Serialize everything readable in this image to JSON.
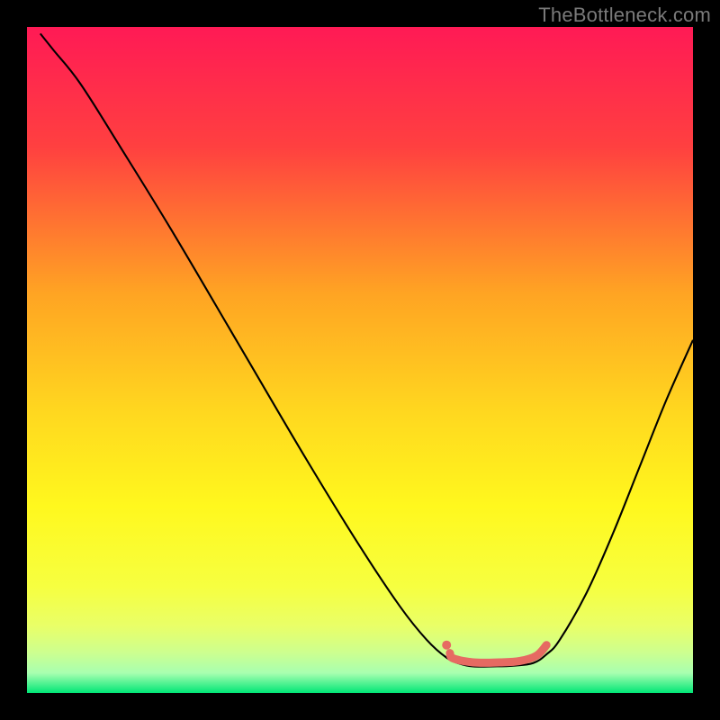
{
  "watermark": {
    "text": "TheBottleneck.com"
  },
  "chart_data": {
    "type": "line",
    "title": "",
    "xlabel": "",
    "ylabel": "",
    "xlim": [
      0,
      100
    ],
    "ylim": [
      0,
      100
    ],
    "grid": false,
    "legend": false,
    "background_gradient": {
      "stops": [
        {
          "offset": 0.0,
          "color": "#ff1a55"
        },
        {
          "offset": 0.18,
          "color": "#ff4040"
        },
        {
          "offset": 0.4,
          "color": "#ffa423"
        },
        {
          "offset": 0.58,
          "color": "#ffd81f"
        },
        {
          "offset": 0.72,
          "color": "#fff81e"
        },
        {
          "offset": 0.84,
          "color": "#f6ff40"
        },
        {
          "offset": 0.9,
          "color": "#e9ff68"
        },
        {
          "offset": 0.94,
          "color": "#ccff90"
        },
        {
          "offset": 0.97,
          "color": "#a8ffb0"
        },
        {
          "offset": 1.0,
          "color": "#00e676"
        }
      ]
    },
    "series": [
      {
        "name": "curve",
        "color": "#000000",
        "width": 2.1,
        "points": [
          {
            "x": 2.0,
            "y": 99.0
          },
          {
            "x": 4.0,
            "y": 96.5
          },
          {
            "x": 8.0,
            "y": 91.5
          },
          {
            "x": 14.0,
            "y": 82.0
          },
          {
            "x": 22.0,
            "y": 69.0
          },
          {
            "x": 32.0,
            "y": 52.0
          },
          {
            "x": 42.0,
            "y": 35.0
          },
          {
            "x": 50.0,
            "y": 22.0
          },
          {
            "x": 56.0,
            "y": 13.0
          },
          {
            "x": 60.0,
            "y": 8.0
          },
          {
            "x": 63.0,
            "y": 5.3
          },
          {
            "x": 65.0,
            "y": 4.4
          },
          {
            "x": 67.0,
            "y": 4.0
          },
          {
            "x": 70.0,
            "y": 4.0
          },
          {
            "x": 73.0,
            "y": 4.1
          },
          {
            "x": 76.0,
            "y": 4.5
          },
          {
            "x": 78.0,
            "y": 5.8
          },
          {
            "x": 80.0,
            "y": 8.0
          },
          {
            "x": 84.0,
            "y": 15.0
          },
          {
            "x": 88.0,
            "y": 24.0
          },
          {
            "x": 92.0,
            "y": 34.0
          },
          {
            "x": 96.0,
            "y": 44.0
          },
          {
            "x": 100.0,
            "y": 53.0
          }
        ]
      },
      {
        "name": "highlight",
        "color": "#e66a62",
        "width": 9,
        "linecap": "round",
        "points": [
          {
            "x": 63.5,
            "y": 6.0
          },
          {
            "x": 64.0,
            "y": 5.2
          },
          {
            "x": 67.0,
            "y": 4.6
          },
          {
            "x": 71.0,
            "y": 4.6
          },
          {
            "x": 74.0,
            "y": 4.8
          },
          {
            "x": 76.5,
            "y": 5.6
          },
          {
            "x": 78.0,
            "y": 7.2
          }
        ]
      },
      {
        "name": "dot",
        "type": "scatter",
        "color": "#e66a62",
        "radius": 5,
        "points": [
          {
            "x": 63.0,
            "y": 7.2
          }
        ]
      }
    ]
  }
}
